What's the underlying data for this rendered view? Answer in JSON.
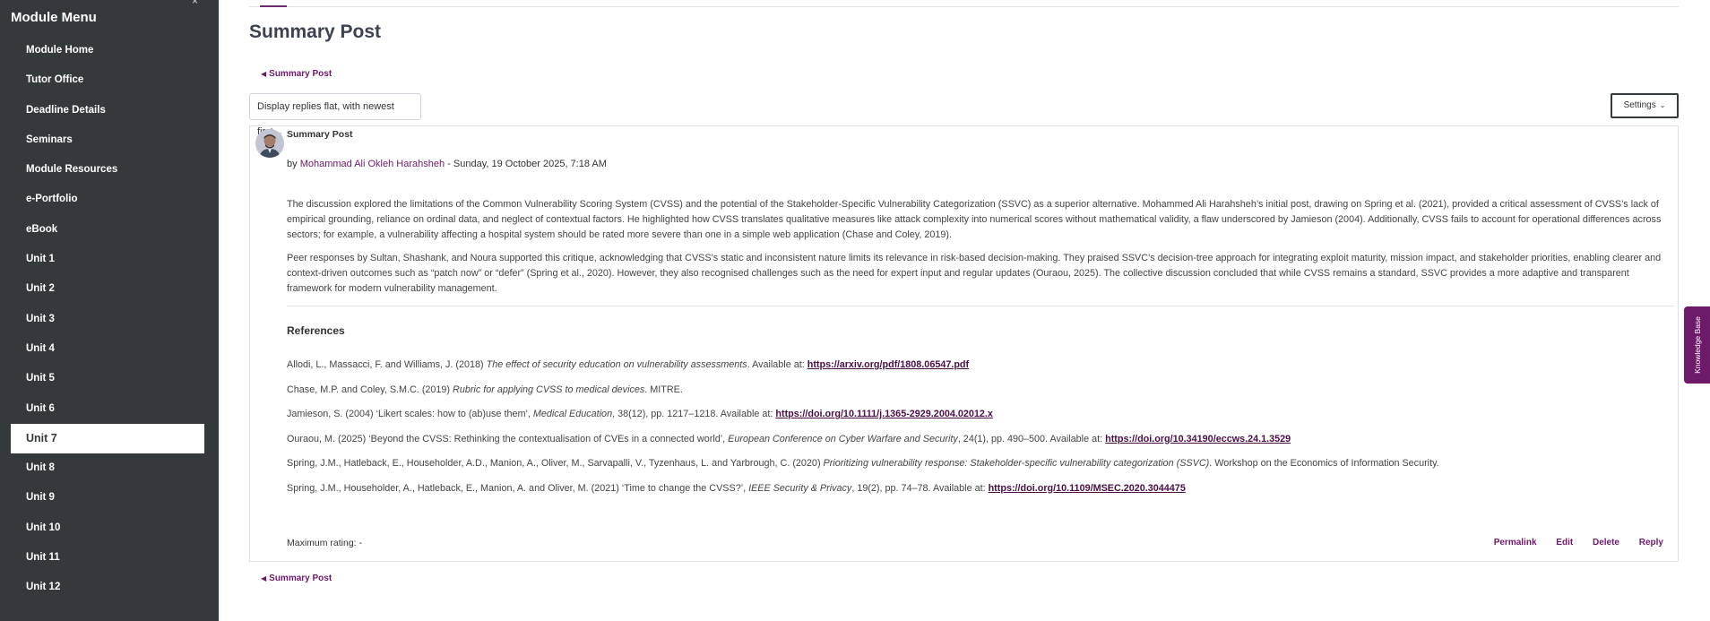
{
  "sidebar": {
    "title": "Module Menu",
    "close_glyph": "×",
    "items": [
      {
        "label": "Module Home"
      },
      {
        "label": "Tutor Office"
      },
      {
        "label": "Deadline Details"
      },
      {
        "label": "Seminars"
      },
      {
        "label": "Module Resources"
      },
      {
        "label": "e-Portfolio"
      },
      {
        "label": "eBook"
      },
      {
        "label": "Unit 1"
      },
      {
        "label": "Unit 2"
      },
      {
        "label": "Unit 3"
      },
      {
        "label": "Unit 4"
      },
      {
        "label": "Unit 5"
      },
      {
        "label": "Unit 6"
      },
      {
        "label": "Unit 7",
        "active": true
      },
      {
        "label": "Unit 8"
      },
      {
        "label": "Unit 9"
      },
      {
        "label": "Unit 10"
      },
      {
        "label": "Unit 11"
      },
      {
        "label": "Unit 12"
      }
    ]
  },
  "page": {
    "title": "Summary Post",
    "back_link_label": "Summary Post",
    "display_mode": "Display replies flat, with newest first",
    "settings_label": "Settings"
  },
  "post": {
    "subject": "Summary Post",
    "by": "by",
    "author": "Mohammad Ali Okleh Harahsheh",
    "date": "- Sunday, 19 October 2025, 7:18 AM",
    "paragraphs": [
      "The discussion explored the limitations of the Common Vulnerability Scoring System (CVSS) and the potential of the Stakeholder-Specific Vulnerability Categorization (SSVC) as a superior alternative. Mohammed Ali Harahsheh’s initial post, drawing on Spring et al. (2021), provided a critical assessment of CVSS’s lack of empirical grounding, reliance on ordinal data, and neglect of contextual factors. He highlighted how CVSS translates qualitative measures like attack complexity into numerical scores without mathematical validity, a flaw underscored by Jamieson (2004). Additionally, CVSS fails to account for operational differences across sectors; for example, a vulnerability affecting a hospital system should be rated more severe than one in a simple web application (Chase and Coley, 2019).",
      "Peer responses by Sultan, Shashank, and Noura supported this critique, acknowledging that CVSS’s static and inconsistent nature limits its relevance in risk-based decision-making. They praised SSVC’s decision-tree approach for integrating exploit maturity, mission impact, and stakeholder priorities, enabling clearer and context-driven outcomes such as “patch now” or “defer” (Spring et al., 2020). However, they also recognised challenges such as the need for expert input and regular updates (Ouraou, 2025). The collective discussion concluded that while CVSS remains a standard, SSVC provides a more adaptive and transparent framework for modern vulnerability management."
    ],
    "references_heading": "References",
    "references": [
      {
        "pre": "Allodi, L., Massacci, F. and Williams, J. (2018) ",
        "italic": "The effect of security education on vulnerability assessments",
        "post": ". Available at: ",
        "link": "https://arxiv.org/pdf/1808.06547.pdf"
      },
      {
        "pre": "Chase, M.P. and Coley, S.M.C. (2019) ",
        "italic": "Rubric for applying CVSS to medical devices",
        "post": ". MITRE.",
        "link": ""
      },
      {
        "pre": "Jamieson, S. (2004) ‘Likert scales: how to (ab)use them’, ",
        "italic": "Medical Education",
        "post": ", 38(12), pp. 1217–1218. Available at: ",
        "link": "https://doi.org/10.1111/j.1365-2929.2004.02012.x"
      },
      {
        "pre": "Ouraou, M. (2025) ‘Beyond the CVSS: Rethinking the contextualisation of CVEs in a connected world’, ",
        "italic": "European Conference on Cyber Warfare and Security",
        "post": ", 24(1), pp. 490–500. Available at: ",
        "link": "https://doi.org/10.34190/eccws.24.1.3529"
      },
      {
        "pre": "Spring, J.M., Hatleback, E., Householder, A.D., Manion, A., Oliver, M., Sarvapalli, V., Tyzenhaus, L. and Yarbrough, C. (2020) ",
        "italic": "Prioritizing vulnerability response: Stakeholder-specific vulnerability categorization (SSVC)",
        "post": ". Workshop on the Economics of Information Security.",
        "link": ""
      },
      {
        "pre": "Spring, J.M., Householder, A., Hatleback, E., Manion, A. and Oliver, M. (2021) ‘Time to change the CVSS?’, ",
        "italic": "IEEE Security & Privacy",
        "post": ", 19(2), pp. 74–78. Available at: ",
        "link": "https://doi.org/10.1109/MSEC.2020.3044475"
      }
    ],
    "max_rating": "Maximum rating: -",
    "actions": {
      "permalink": "Permalink",
      "edit": "Edit",
      "delete": "Delete",
      "reply": "Reply"
    }
  },
  "knowledge_base_tab": "Knowledge Base",
  "icons": {
    "back_arrow": "back-triangle-icon",
    "chevron": "chevron-down-icon",
    "avatar": "user-avatar"
  },
  "colors": {
    "sidebar_bg": "#343a3c",
    "accent": "#6e1a6b",
    "link_dark": "#4a0e47"
  }
}
